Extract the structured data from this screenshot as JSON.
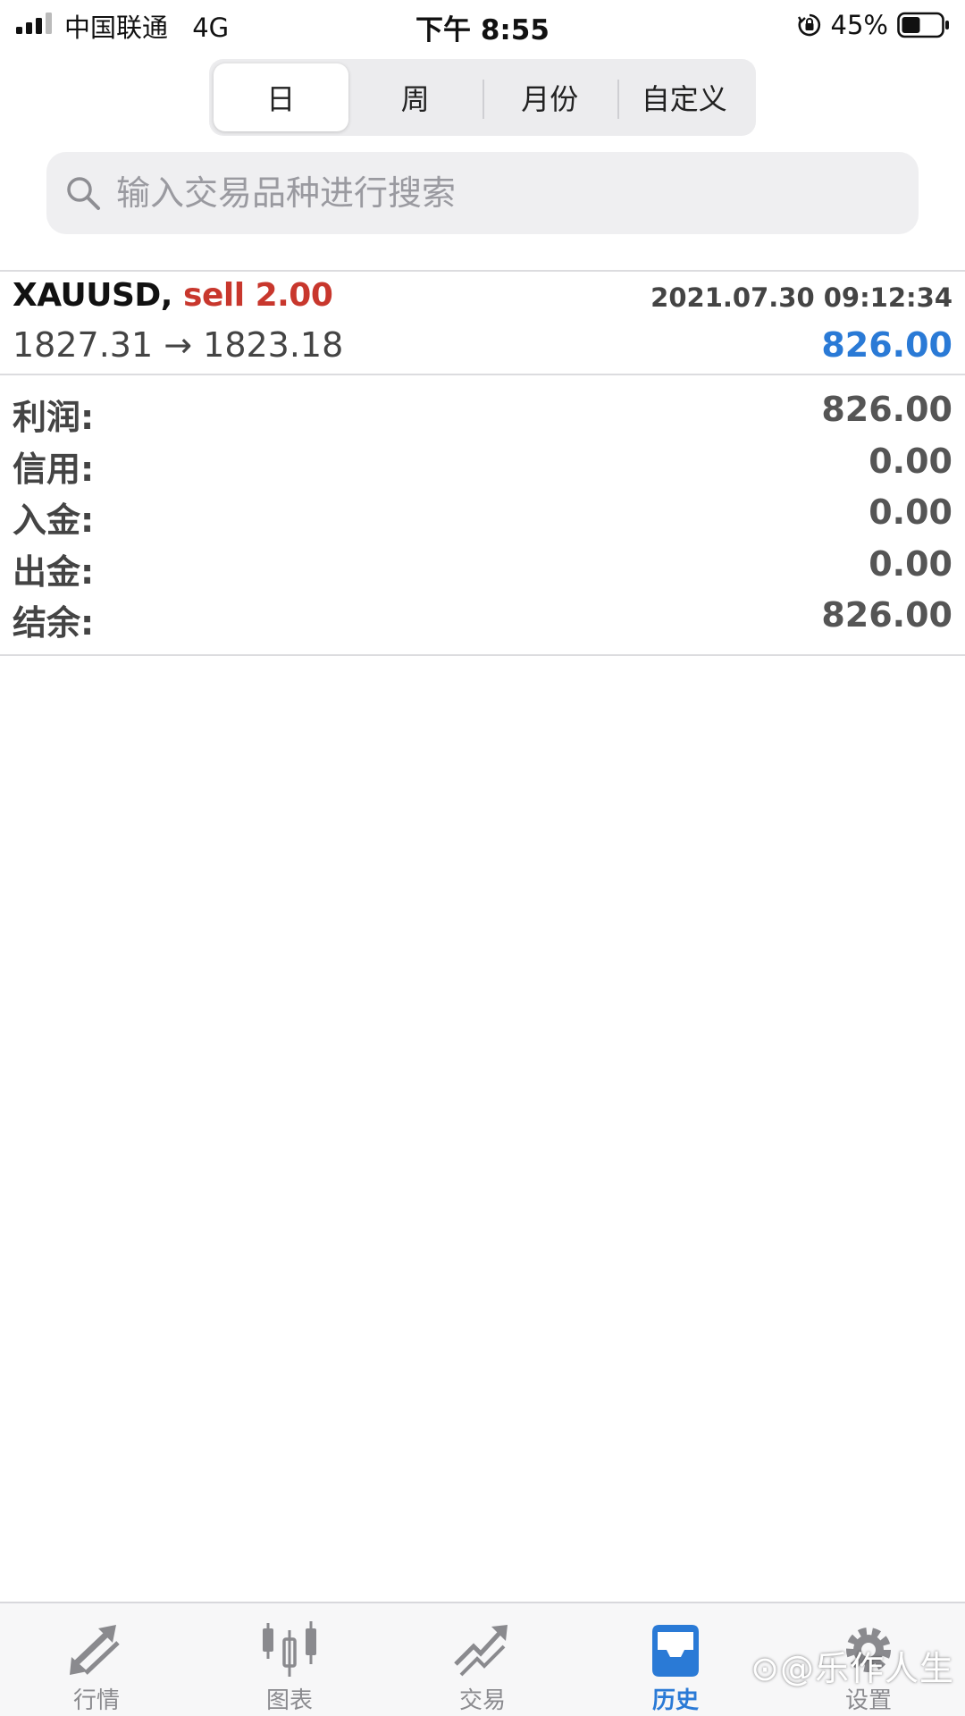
{
  "status_bar": {
    "carrier": "中国联通",
    "network": "4G",
    "time": "下午 8:55",
    "battery": "45%"
  },
  "period_tabs": [
    {
      "label": "日",
      "active": true
    },
    {
      "label": "周",
      "active": false
    },
    {
      "label": "月份",
      "active": false
    },
    {
      "label": "自定义",
      "active": false
    }
  ],
  "search": {
    "placeholder": "输入交易品种进行搜索",
    "value": ""
  },
  "trade": {
    "symbol": "XAUUSD,",
    "side": "sell 2.00",
    "time": "2021.07.30 09:12:34",
    "prices": "1827.31 → 1823.18",
    "profit": "826.00"
  },
  "summary": [
    {
      "label": "利润:",
      "value": "826.00"
    },
    {
      "label": "信用:",
      "value": "0.00"
    },
    {
      "label": "入金:",
      "value": "0.00"
    },
    {
      "label": "出金:",
      "value": "0.00"
    },
    {
      "label": "结余:",
      "value": "826.00"
    }
  ],
  "tabbar": [
    {
      "label": "行情",
      "icon": "quotes-arrows-icon",
      "active": false
    },
    {
      "label": "图表",
      "icon": "candlestick-chart-icon",
      "active": false
    },
    {
      "label": "交易",
      "icon": "trade-trend-icon",
      "active": false
    },
    {
      "label": "历史",
      "icon": "history-inbox-icon",
      "active": true
    },
    {
      "label": "设置",
      "icon": "gear-icon",
      "active": false
    }
  ],
  "watermark": "⊙@乐作人生",
  "colors": {
    "accent": "#2a7ad6",
    "sell": "#c8372d",
    "inactive_tab": "#8a8a8e"
  }
}
